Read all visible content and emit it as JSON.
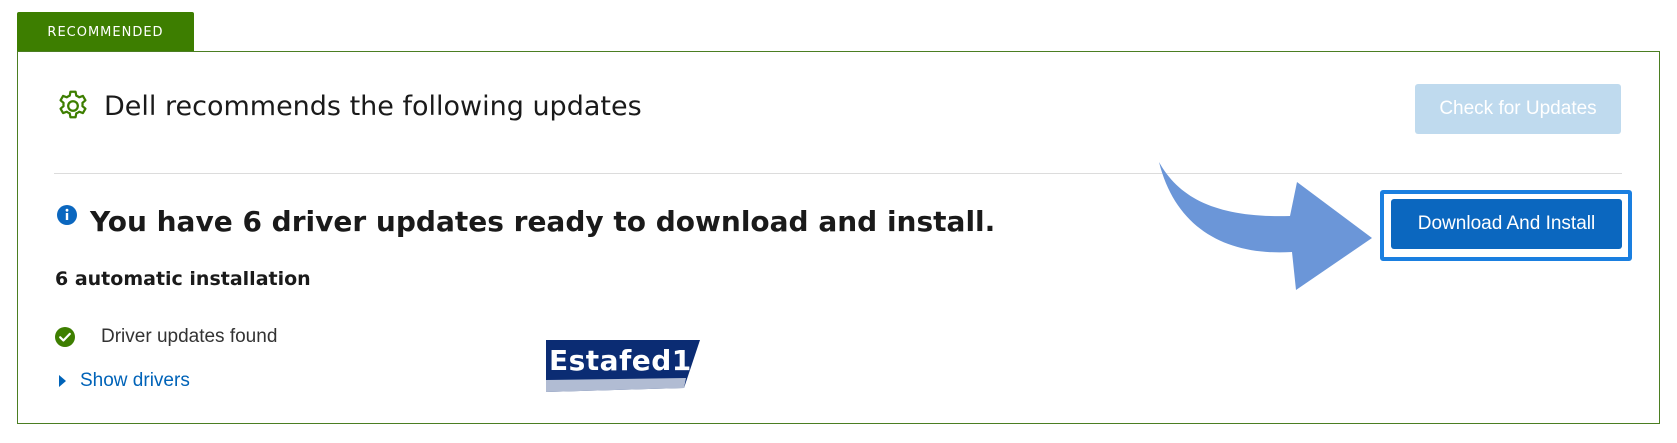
{
  "tag": {
    "label": "RECOMMENDED"
  },
  "header": {
    "title": "Dell recommends the following updates",
    "icon": "gear-icon",
    "check_button_label": "Check for Updates"
  },
  "info": {
    "icon": "info-icon",
    "prefix": "You have ",
    "count": "6",
    "suffix": " driver updates ready to download and install."
  },
  "auto_install": "6 automatic installation",
  "status": {
    "icon": "check-circle-icon",
    "text": "Driver updates found"
  },
  "show_drivers": {
    "label": "Show drivers",
    "icon": "caret-right-icon"
  },
  "download_button_label": "Download And Install",
  "watermark": {
    "text": "Estafed1"
  },
  "colors": {
    "brand_green": "#3d7e00",
    "card_border": "#4b7e22",
    "primary_blue": "#0b67bf",
    "disabled_blue": "#bfdaee",
    "link_blue": "#0063b8",
    "highlight_blue": "#1a7fe0",
    "arrow_blue": "#6b96d8"
  }
}
